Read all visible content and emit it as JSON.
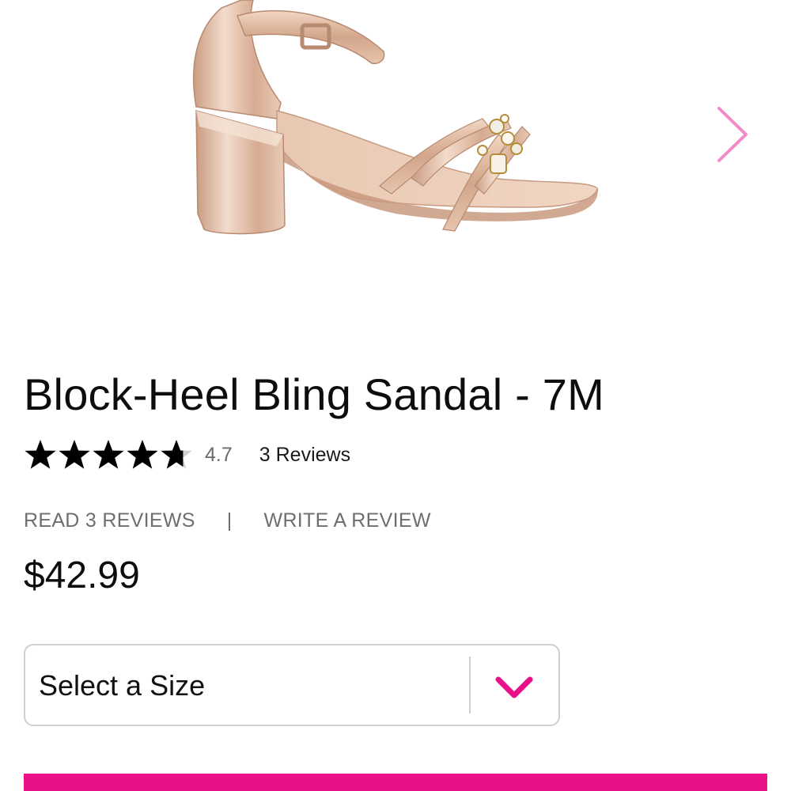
{
  "product": {
    "title": "Block-Heel Bling Sandal - 7M",
    "rating_value": "4.7",
    "rating_stars": 4.7,
    "max_stars": 5,
    "review_count_text": "3 Reviews",
    "price": "$42.99"
  },
  "review_links": {
    "read_label": "READ 3 REVIEWS",
    "separator": "|",
    "write_label": "WRITE A REVIEW"
  },
  "size_selector": {
    "selected_label": "Select a Size",
    "chevron_icon": "chevron-down-icon"
  },
  "gallery": {
    "next_icon": "chevron-right-icon",
    "image_subject": "rose-gold-block-heel-sandal"
  },
  "colors": {
    "accent": "#e8118a",
    "arrow": "#f28ac8",
    "rose_gold": "#d9b49b"
  }
}
